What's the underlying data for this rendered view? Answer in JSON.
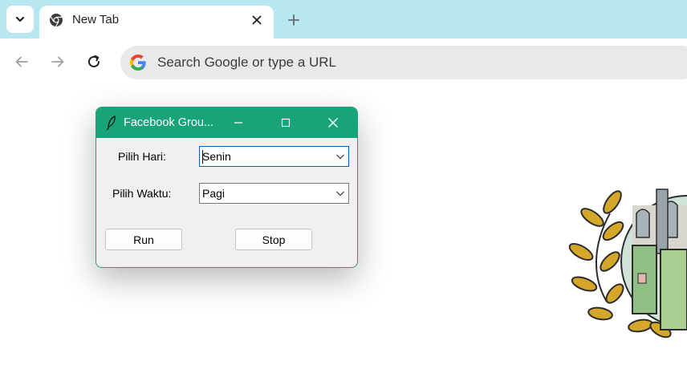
{
  "browser": {
    "tab_title": "New Tab",
    "omnibox_placeholder": "Search Google or type a URL",
    "icons": {
      "tab_search": "chevron-down-icon",
      "favicon": "chrome-icon",
      "tab_close": "close-icon",
      "new_tab": "plus-icon",
      "back": "arrow-left-icon",
      "forward": "arrow-right-icon",
      "reload": "reload-icon",
      "google": "google-g-icon"
    },
    "colors": {
      "tabstrip": "#b8e7f2",
      "omnibox": "#e9e9e9"
    }
  },
  "dialog": {
    "title": "Facebook Grou...",
    "colors": {
      "titlebar": "#18a37b",
      "body": "#f0f0f0",
      "focus": "#0b5fb8"
    },
    "day_label": "Pilih Hari:",
    "day_value": "Senin",
    "time_label": "Pilih Waktu:",
    "time_value": "Pagi",
    "run_label": "Run",
    "stop_label": "Stop"
  }
}
